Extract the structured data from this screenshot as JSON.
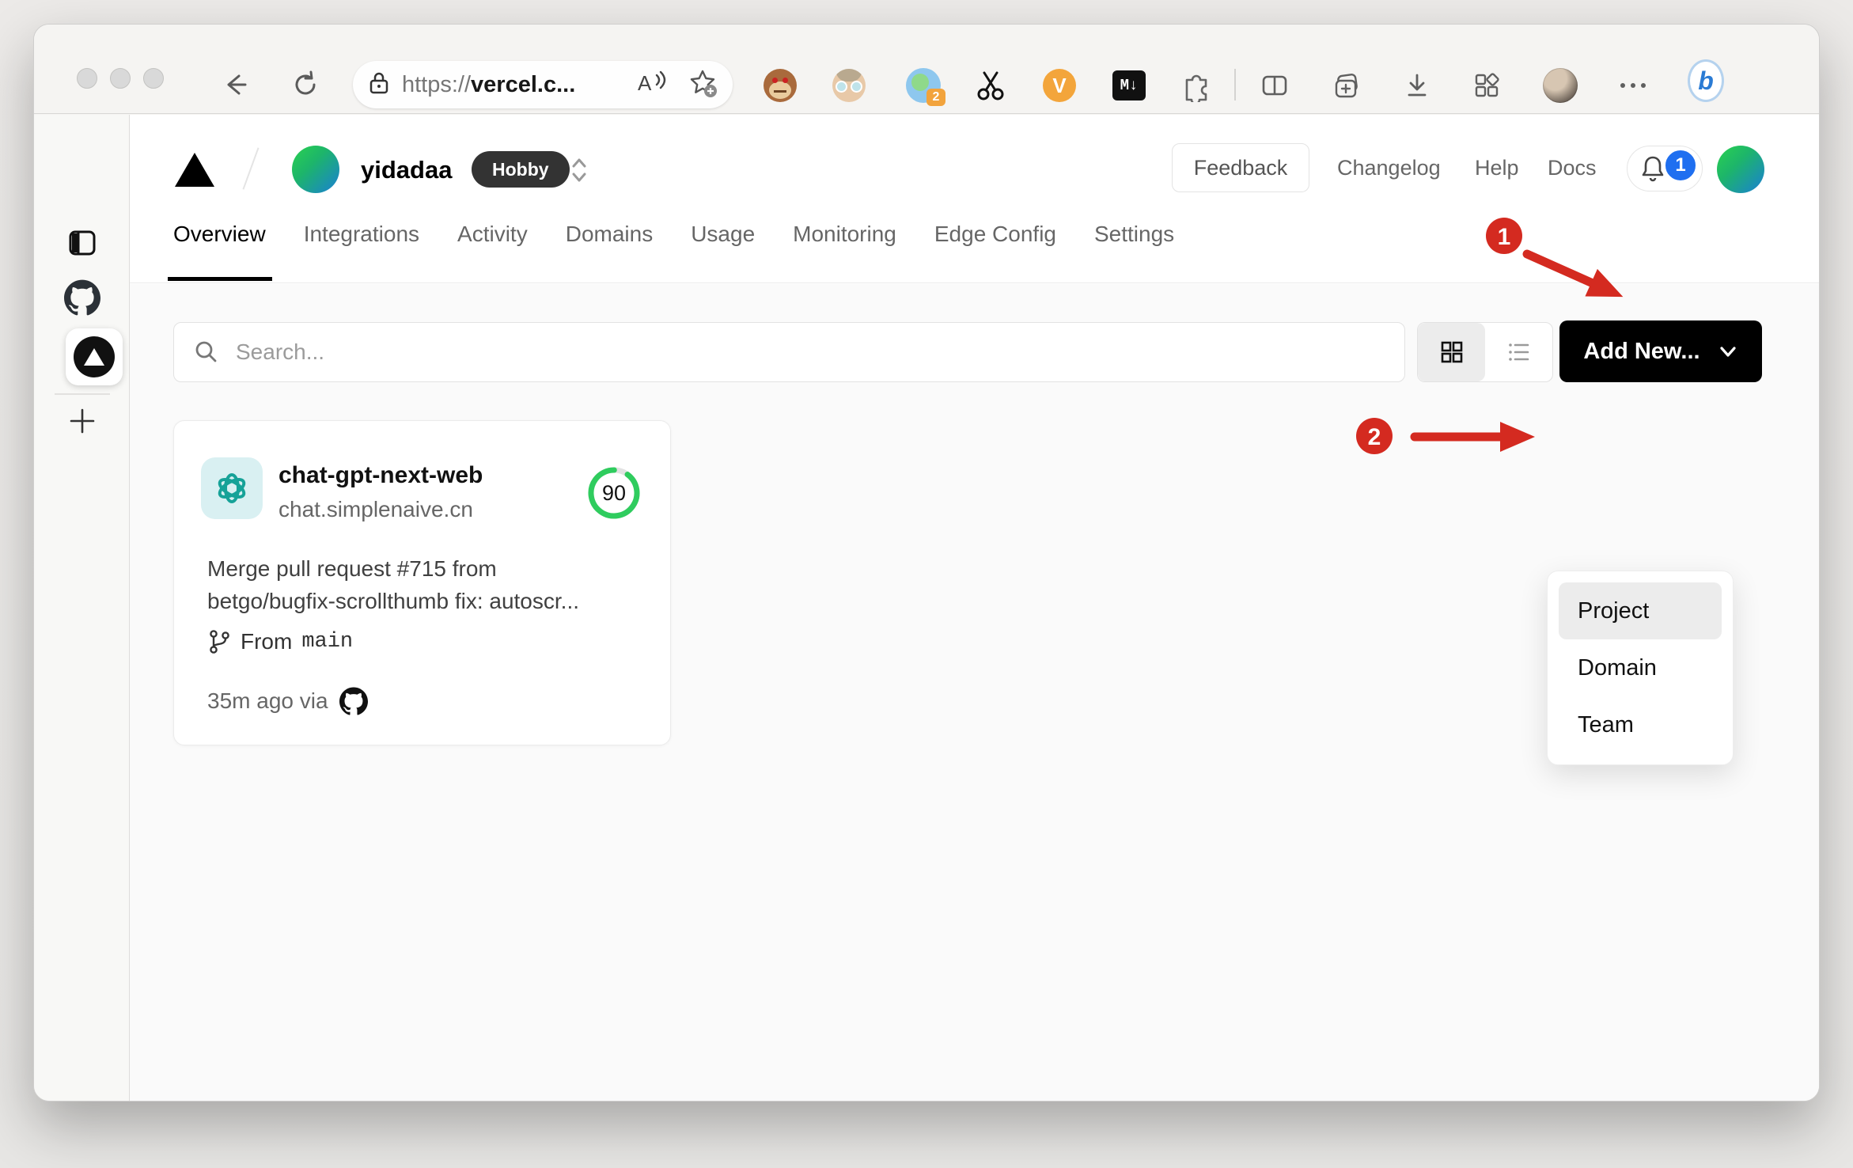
{
  "browser": {
    "url": {
      "protocol": "https://",
      "host": "vercel.c..."
    },
    "extension_badge": "2",
    "markdown_ext_label": "M↓",
    "vimium_ext_label": "V",
    "bing_label": "b"
  },
  "vercel": {
    "header": {
      "team": "yidadaa",
      "plan": "Hobby",
      "feedback": "Feedback",
      "changelog": "Changelog",
      "help": "Help",
      "docs": "Docs",
      "notification_count": "1"
    },
    "tabs": [
      "Overview",
      "Integrations",
      "Activity",
      "Domains",
      "Usage",
      "Monitoring",
      "Edge Config",
      "Settings"
    ],
    "search_placeholder": "Search...",
    "add_new_label": "Add New...",
    "card": {
      "name": "chat-gpt-next-web",
      "domain": "chat.simplenaive.cn",
      "score": "90",
      "commit_line1": "Merge pull request #715 from",
      "commit_line2": "betgo/bugfix-scrollthumb fix: autoscr...",
      "branch_prefix": "From",
      "branch": "main",
      "deployed": "35m ago via"
    },
    "dropdown": [
      "Project",
      "Domain",
      "Team"
    ]
  },
  "annotations": {
    "one": "1",
    "two": "2"
  },
  "colors": {
    "annotation_red": "#d42a20",
    "score_green": "#2fcc5e",
    "badge_blue": "#1f6ff0"
  }
}
